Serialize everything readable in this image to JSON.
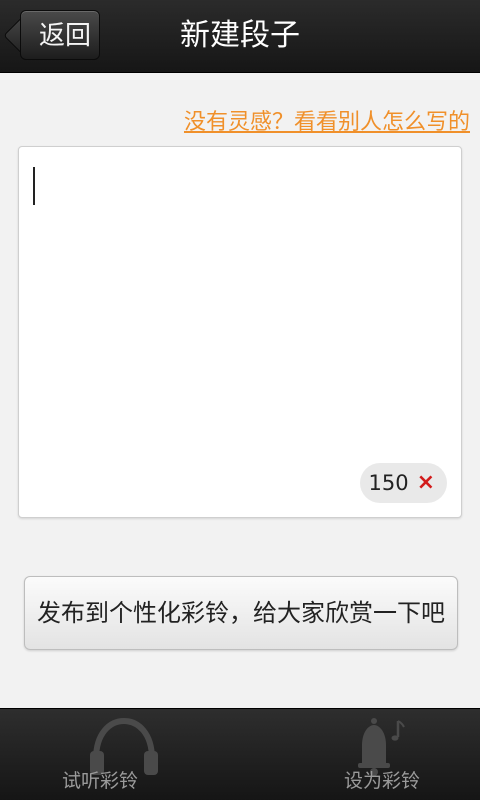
{
  "header": {
    "back_label": "返回",
    "title": "新建段子"
  },
  "inspiration": {
    "link_text": "没有灵感？看看别人怎么写的"
  },
  "editor": {
    "value": "",
    "remaining_count": "150",
    "clear_symbol": "×"
  },
  "publish": {
    "label": "发布到个性化彩铃，给大家欣赏一下吧"
  },
  "bottom_bar": {
    "tabs": [
      {
        "label": "试听彩铃",
        "icon": "headphones-icon"
      },
      {
        "label": "设为彩铃",
        "icon": "bell-icon"
      }
    ]
  },
  "colors": {
    "accent_link": "#f0902a",
    "clear_icon": "#d21b1b",
    "header_bg": "#1f1f1f"
  }
}
